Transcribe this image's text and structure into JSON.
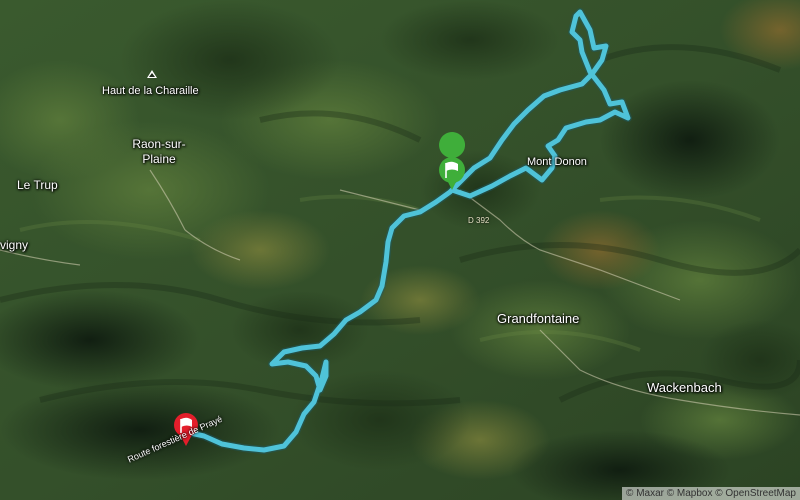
{
  "map": {
    "places": [
      {
        "id": "haut-de-la-charaille",
        "text": "Haut de la Charaille"
      },
      {
        "id": "raon-sur-plaine",
        "text": "Raon-sur-\nPlaine"
      },
      {
        "id": "le-trup",
        "text": "Le Trup"
      },
      {
        "id": "vigny",
        "text": "vigny"
      },
      {
        "id": "mont-donon",
        "text": "Mont Donon"
      },
      {
        "id": "grandfontaine",
        "text": "Grandfontaine"
      },
      {
        "id": "wackenbach",
        "text": "Wackenbach"
      }
    ],
    "road_label": "Route forestière de Prayé",
    "road_number": "D 392",
    "start_marker": "start-flag",
    "finish_marker": "finish-flag",
    "route_color": "#4fc3d9",
    "start_color": "#3fae3a",
    "finish_color": "#e41e2b",
    "attribution": "© Maxar © Mapbox © OpenStreetMap"
  }
}
